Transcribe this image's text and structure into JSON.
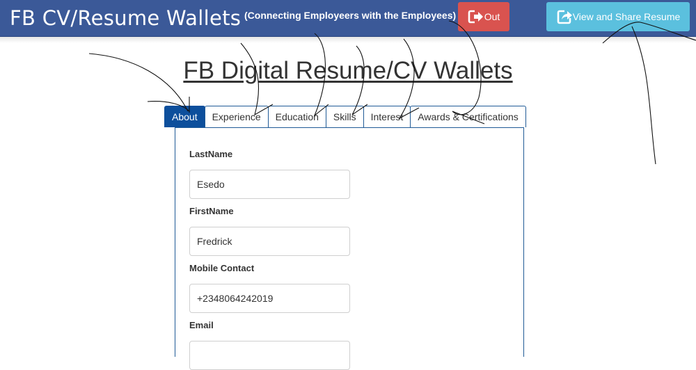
{
  "header": {
    "brand": "FB CV/Resume Wallets",
    "tagline": "(Connecting Employeers with the Employees)",
    "out_label": "Out",
    "share_label": "View and Share Resume"
  },
  "page": {
    "title": "FB Digital Resume/CV Wallets"
  },
  "tabs": [
    {
      "label": "About",
      "active": true
    },
    {
      "label": "Experience"
    },
    {
      "label": "Education"
    },
    {
      "label": "Skills"
    },
    {
      "label": "Interest"
    },
    {
      "label": "Awards & Certifications"
    }
  ],
  "form": {
    "lastname": {
      "label": "LastName",
      "value": "Esedo"
    },
    "firstname": {
      "label": "FirstName",
      "value": "Fredrick"
    },
    "mobile": {
      "label": "Mobile Contact",
      "value": "+2348064242019"
    },
    "email": {
      "label": "Email",
      "value": ""
    }
  },
  "colors": {
    "header": "#3b5998",
    "out_button": "#d9534f",
    "share_button": "#5bc0de",
    "active_tab": "#0d4f9c"
  },
  "icons": {
    "out": "sign-out-icon",
    "share": "share-icon"
  }
}
